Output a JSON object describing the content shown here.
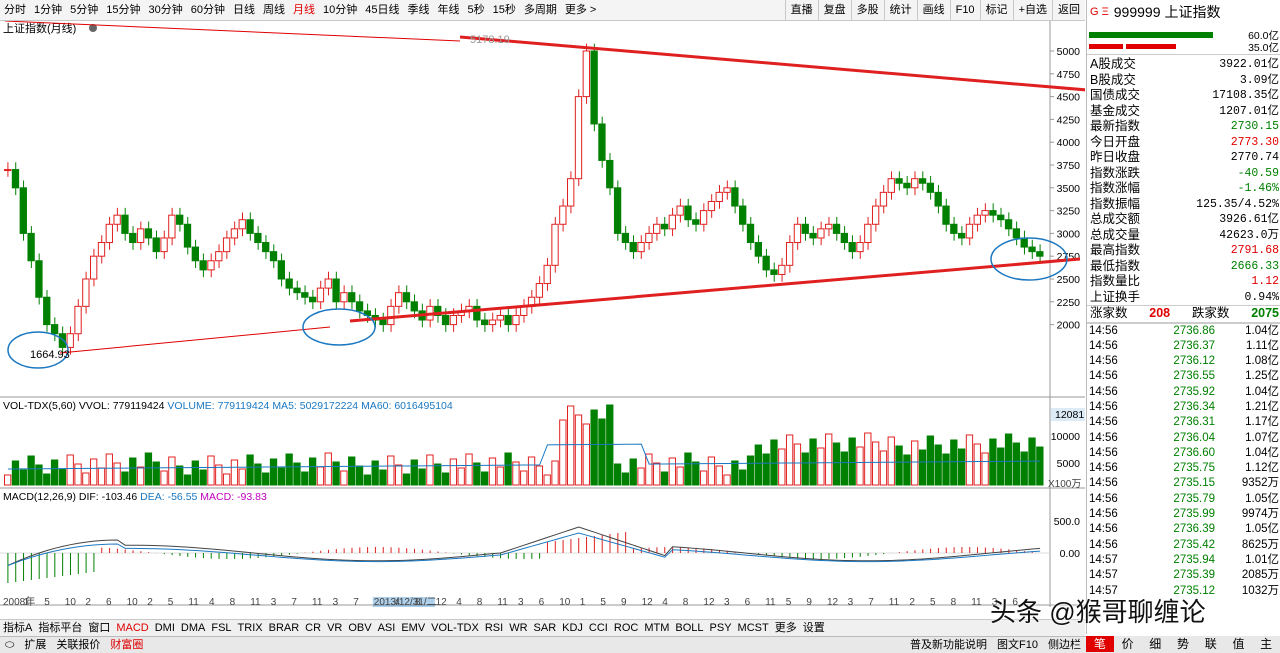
{
  "toolbar": {
    "periods": [
      "分时",
      "1分钟",
      "5分钟",
      "15分钟",
      "30分钟",
      "60分钟",
      "日线",
      "周线",
      "月线",
      "10分钟",
      "45日线",
      "季线",
      "年线",
      "5秒",
      "15秒",
      "多周期",
      "更多 >"
    ],
    "active_period": "月线",
    "right_buttons": [
      "直播",
      "复盘",
      "多股",
      "统计",
      "画线",
      "F10",
      "标记",
      "+自选",
      "返回"
    ]
  },
  "main_chart": {
    "title": "上证指数(月线)",
    "y_axis": [
      "5000",
      "4750",
      "4500",
      "4250",
      "4000",
      "3750",
      "3500",
      "3250",
      "3000",
      "2750",
      "2500",
      "2250",
      "2000"
    ],
    "low_label": "1664.93",
    "high_label": "5178.19"
  },
  "volume_pane": {
    "title": "VOL-TDX(5,60)",
    "vvol_label": "VVOL: 779119424",
    "volume_label": "VOLUME: 779119424",
    "ma5_label": "MA5: 5029172224",
    "ma60_label": "MA60: 6016495104",
    "y_axis": [
      "10000",
      "5000"
    ],
    "top_value": "12081",
    "unit": "X100万"
  },
  "macd_pane": {
    "title": "MACD(12,26,9)",
    "dif_label": "DIF: -103.46",
    "dea_label": "DEA: -56.55",
    "macd_label": "MACD: -93.83",
    "y_axis": [
      "500.0",
      "0.00"
    ]
  },
  "x_axis": {
    "labels": [
      "2008年",
      "1",
      "5",
      "10",
      "2",
      "6",
      "10",
      "2",
      "5",
      "11",
      "4",
      "8",
      "11",
      "3",
      "7",
      "11",
      "3",
      "7",
      "2013/12/31/二",
      "4",
      "8",
      "12",
      "4",
      "8",
      "11",
      "3",
      "6",
      "10",
      "1",
      "5",
      "9",
      "12",
      "4",
      "8",
      "12",
      "3",
      "6",
      "11",
      "5",
      "9",
      "12",
      "3",
      "7",
      "11",
      "2",
      "5",
      "8",
      "11",
      "3",
      "6"
    ]
  },
  "indicators": [
    "指标A",
    "指标平台",
    "窗口",
    "MACD",
    "DMI",
    "DMA",
    "FSL",
    "TRIX",
    "BRAR",
    "CR",
    "VR",
    "OBV",
    "ASI",
    "EMV",
    "VOL-TDX",
    "RSI",
    "WR",
    "SAR",
    "KDJ",
    "CCI",
    "ROC",
    "MTM",
    "BOLL",
    "PSY",
    "MCST",
    "更多",
    "设置"
  ],
  "active_indicator": "MACD",
  "status": {
    "items": [
      "扩展",
      "关联报价",
      "财富圈"
    ],
    "right_items": [
      "普及新功能说明",
      "图文F10",
      "侧边栏"
    ]
  },
  "side_panel": {
    "code": "999999",
    "name": "上证指数",
    "bar_labels": [
      "60.0亿",
      "35.0亿"
    ],
    "rows": [
      {
        "label": "A股成交",
        "value": "3922.01亿",
        "color": "#000000"
      },
      {
        "label": "B股成交",
        "value": "3.09亿",
        "color": "#000000"
      },
      {
        "label": "国债成交",
        "value": "17108.35亿",
        "color": "#000000"
      },
      {
        "label": "基金成交",
        "value": "1207.01亿",
        "color": "#000000"
      },
      {
        "label": "最新指数",
        "value": "2730.15",
        "color": "#008000"
      },
      {
        "label": "今日开盘",
        "value": "2773.30",
        "color": "#e00000"
      },
      {
        "label": "昨日收盘",
        "value": "2770.74",
        "color": "#000000"
      },
      {
        "label": "指数涨跌",
        "value": "-40.59",
        "color": "#008000"
      },
      {
        "label": "指数涨幅",
        "value": "-1.46%",
        "color": "#008000"
      },
      {
        "label": "指数振幅",
        "value": "125.35/4.52%",
        "color": "#000000"
      },
      {
        "label": "总成交额",
        "value": "3926.61亿",
        "color": "#000000"
      },
      {
        "label": "总成交量",
        "value": "42623.0万",
        "color": "#000000"
      },
      {
        "label": "最高指数",
        "value": "2791.68",
        "color": "#e00000"
      },
      {
        "label": "最低指数",
        "value": "2666.33",
        "color": "#008000"
      },
      {
        "label": "指数量比",
        "value": "1.12",
        "color": "#e00000"
      },
      {
        "label": "上证换手",
        "value": "0.94%",
        "color": "#000000"
      }
    ],
    "up_label": "涨家数",
    "up_count": "208",
    "down_label": "跌家数",
    "down_count": "2075",
    "ticks": [
      {
        "t": "14:56",
        "p": "2736.86",
        "v": "1.04亿"
      },
      {
        "t": "14:56",
        "p": "2736.37",
        "v": "1.11亿"
      },
      {
        "t": "14:56",
        "p": "2736.12",
        "v": "1.08亿"
      },
      {
        "t": "14:56",
        "p": "2736.55",
        "v": "1.25亿"
      },
      {
        "t": "14:56",
        "p": "2735.92",
        "v": "1.04亿"
      },
      {
        "t": "14:56",
        "p": "2736.34",
        "v": "1.21亿"
      },
      {
        "t": "14:56",
        "p": "2736.31",
        "v": "1.17亿"
      },
      {
        "t": "14:56",
        "p": "2736.04",
        "v": "1.07亿"
      },
      {
        "t": "14:56",
        "p": "2736.60",
        "v": "1.04亿"
      },
      {
        "t": "14:56",
        "p": "2735.75",
        "v": "1.12亿"
      },
      {
        "t": "14:56",
        "p": "2735.15",
        "v": "9352万"
      },
      {
        "t": "14:56",
        "p": "2735.79",
        "v": "1.05亿"
      },
      {
        "t": "14:56",
        "p": "2735.99",
        "v": "9974万"
      },
      {
        "t": "14:56",
        "p": "2736.39",
        "v": "1.05亿"
      },
      {
        "t": "14:56",
        "p": "2735.42",
        "v": "8625万"
      },
      {
        "t": "14:57",
        "p": "2735.94",
        "v": "1.01亿"
      },
      {
        "t": "14:57",
        "p": "2735.39",
        "v": "2085万"
      },
      {
        "t": "14:57",
        "p": "2735.12",
        "v": "1032万"
      }
    ],
    "tabs": [
      "笔",
      "价",
      "细",
      "势",
      "联",
      "值",
      "主"
    ]
  },
  "watermark": "头条 @猴哥聊缠论"
}
